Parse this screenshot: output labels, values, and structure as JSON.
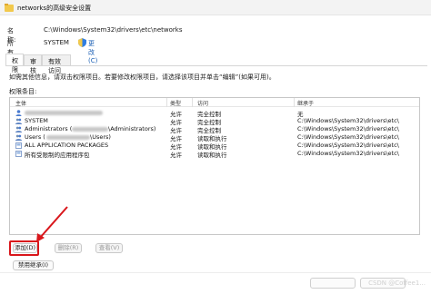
{
  "window": {
    "title": "networks的高级安全设置"
  },
  "info": {
    "name_label": "名称:",
    "name_value": "C:\\Windows\\System32\\drivers\\etc\\networks",
    "owner_label": "所有者:",
    "owner_value": "SYSTEM",
    "change_link": "更改(C)"
  },
  "tabs": [
    {
      "label": "权限",
      "active": true
    },
    {
      "label": "审核",
      "active": false
    },
    {
      "label": "有效访问",
      "active": false
    }
  ],
  "description": "如需其他信息，请双击权限项目。若要修改权限项目，请选择该项目并单击“编辑”(如果可用)。",
  "entries_title": "权限条目:",
  "columns": {
    "principal": "主体",
    "type": "类型",
    "access": "访问",
    "inherited": "继承于"
  },
  "rows": [
    {
      "principal": "",
      "type": "允许",
      "access": "完全控制",
      "inherited": "无",
      "icon": "user-icon",
      "redacted": true
    },
    {
      "principal": "SYSTEM",
      "type": "允许",
      "access": "完全控制",
      "inherited": "C:\\Windows\\System32\\drivers\\etc\\",
      "icon": "group-icon"
    },
    {
      "principal": "Administrators (",
      "principal_tail": "\\Administrators)",
      "type": "允许",
      "access": "完全控制",
      "inherited": "C:\\Windows\\System32\\drivers\\etc\\",
      "icon": "group-icon",
      "redacted": true
    },
    {
      "principal": "Users (",
      "principal_tail": "\\Users)",
      "type": "允许",
      "access": "读取和执行",
      "inherited": "C:\\Windows\\System32\\drivers\\etc\\",
      "icon": "group-icon",
      "redacted": true
    },
    {
      "principal": "ALL APPLICATION PACKAGES",
      "type": "允许",
      "access": "读取和执行",
      "inherited": "C:\\Windows\\System32\\drivers\\etc\\",
      "icon": "package-icon"
    },
    {
      "principal": "所有受限制的应用程序包",
      "type": "允许",
      "access": "读取和执行",
      "inherited": "C:\\Windows\\System32\\drivers\\etc\\",
      "icon": "package-icon"
    }
  ],
  "buttons": {
    "add": "添加(D)",
    "remove": "删除(R)",
    "view": "查看(V)",
    "disable_inheritance": "禁用继承(I)"
  },
  "watermark": "CSDN @Coffee1..."
}
